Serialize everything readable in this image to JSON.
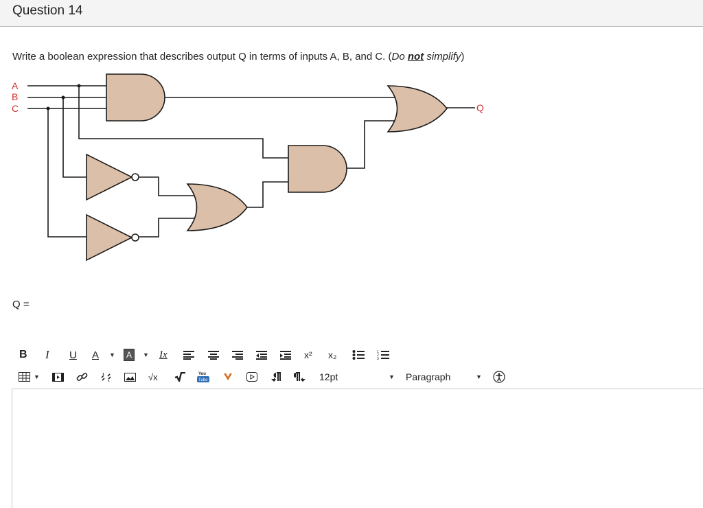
{
  "question": {
    "title": "Question 14"
  },
  "prompt": {
    "text_main": "Write a boolean expression that describes output Q in terms of inputs A, B, and C. (",
    "text_do": "Do ",
    "text_not": "not",
    "text_simplify": " simplify",
    "text_close": ")"
  },
  "circuit": {
    "inputs": [
      "A",
      "B",
      "C"
    ],
    "output": "Q",
    "label_color": "#d0312d",
    "gate_fill": "#dcbfa8",
    "wire_color": "#1a1a1a"
  },
  "answer": {
    "label": "Q ="
  },
  "toolbar": {
    "bold": "B",
    "italic": "I",
    "underline": "U",
    "font_color": "A",
    "highlight": "A",
    "clear_format": "Ix",
    "superscript": "x²",
    "subscript": "x₂",
    "sqrt": "√x",
    "youtube": "You Tube",
    "font_size": "12pt",
    "block_format": "Paragraph"
  },
  "editor": {
    "value": ""
  }
}
